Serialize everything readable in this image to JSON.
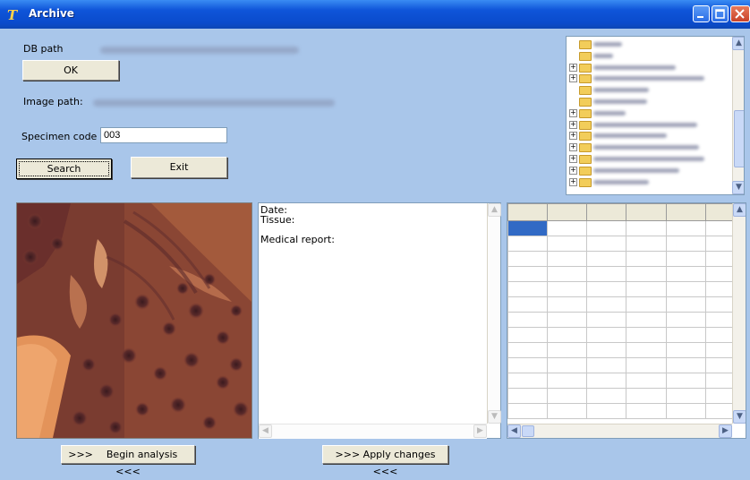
{
  "window": {
    "title": "Archive",
    "icon": "app-logo-icon"
  },
  "form": {
    "db_path_label": "DB path",
    "ok_label": "OK",
    "image_path_label": "Image path:",
    "specimen_label": "Specimen code",
    "specimen_value": "003",
    "search_label": "Search",
    "exit_label": "Exit"
  },
  "report": {
    "date_label": "Date:",
    "tissue_label": "Tissue:",
    "medical_report_label": "Medical report:"
  },
  "bottom": {
    "begin_analysis_prefix": ">>>",
    "begin_analysis_label": "Begin analysis",
    "begin_analysis_suffix": "<<<",
    "apply_changes_label": ">>> Apply changes <<<"
  },
  "colors": {
    "titlebar": "#0a4bcc",
    "background": "#a9c6ea",
    "selection": "#316ac5"
  }
}
